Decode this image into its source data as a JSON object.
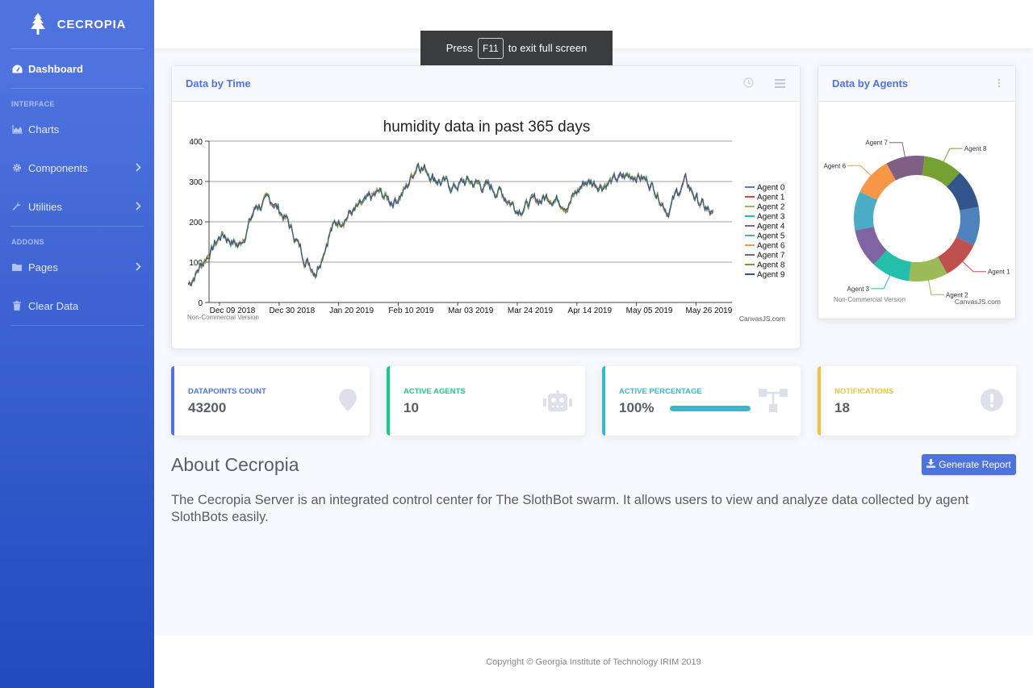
{
  "brand": {
    "name": "CECROPIA",
    "icon": "tree-icon"
  },
  "sidebar": {
    "dashboard": "Dashboard",
    "heading_interface": "INTERFACE",
    "charts": "Charts",
    "components": "Components",
    "utilities": "Utilities",
    "heading_addons": "ADDONS",
    "pages": "Pages",
    "clear_data": "Clear Data"
  },
  "fullscreen_toast": {
    "press": "Press",
    "key": "F11",
    "rest": "to exit full screen"
  },
  "time_card": {
    "title": "Data by Time",
    "icons": [
      "clock-icon",
      "menu-icon"
    ],
    "watermark_left": "Non-Commercial Version",
    "watermark_right": "CanvasJS.com"
  },
  "agents_card": {
    "title": "Data by Agents",
    "icons": [
      "more-vertical-icon"
    ],
    "watermark_left": "Non-Commercial Version",
    "watermark_right": "CanvasJS.com"
  },
  "stats": [
    {
      "label": "DATAPOINTS COUNT",
      "value": "43200",
      "color": "#4e73df",
      "icon": "map-marker-icon"
    },
    {
      "label": "ACTIVE AGENTS",
      "value": "10",
      "color": "#1cc88a",
      "icon": "robot-icon"
    },
    {
      "label": "ACTIVE PERCENTAGE",
      "value": "100%",
      "color": "#36b9cc",
      "icon": "network-icon",
      "progress": 1.0
    },
    {
      "label": "NOTIFICATIONS",
      "value": "18",
      "color": "#f6c23e",
      "icon": "exclamation-circle-icon"
    }
  ],
  "about": {
    "title": "About Cecropia",
    "text": "The Cecropia Server is an integrated control center for The SlothBot swarm. It allows users to view and analyze data collected by agent SlothBots easily.",
    "button": "Generate Report"
  },
  "footer": "Copyright © Georgia Institute of Technology IRIM 2019",
  "chart_data": [
    {
      "type": "line",
      "title": "humidity data in past 365 days",
      "x_ticks": [
        "Dec 09 2018",
        "Dec 30 2018",
        "Jan 20 2019",
        "Feb 10 2019",
        "Mar 03 2019",
        "Mar 24 2019",
        "Apr 14 2019",
        "May 05 2019",
        "May 26 2019"
      ],
      "ylim": [
        0,
        400
      ],
      "y_ticks": [
        0,
        100,
        200,
        300,
        400
      ],
      "grid": true,
      "legend_position": "right",
      "series_names": [
        "Agent 0",
        "Agent 1",
        "Agent 2",
        "Agent 3",
        "Agent 4",
        "Agent 5",
        "Agent 6",
        "Agent 7",
        "Agent 8",
        "Agent 9"
      ],
      "series_colors": [
        "#4f81bc",
        "#c0504e",
        "#9bbb58",
        "#23bfaa",
        "#8064a1",
        "#4aacc5",
        "#f79647",
        "#7f6084",
        "#77a033",
        "#33558b"
      ],
      "x": [
        "2018-11-28",
        "2018-12-05",
        "2018-12-10",
        "2018-12-16",
        "2018-12-22",
        "2018-12-28",
        "2019-01-02",
        "2019-01-08",
        "2019-01-12",
        "2019-01-17",
        "2019-01-22",
        "2019-01-28",
        "2019-02-03",
        "2019-02-08",
        "2019-02-13",
        "2019-02-17",
        "2019-02-23",
        "2019-03-01",
        "2019-03-06",
        "2019-03-12",
        "2019-03-18",
        "2019-03-24",
        "2019-03-30",
        "2019-04-05",
        "2019-04-11",
        "2019-04-17",
        "2019-04-23",
        "2019-04-29",
        "2019-05-05",
        "2019-05-11",
        "2019-05-16",
        "2019-05-22",
        "2019-05-27",
        "2019-06-01"
      ],
      "values": [
        45,
        120,
        170,
        140,
        240,
        250,
        200,
        110,
        80,
        180,
        215,
        235,
        270,
        250,
        285,
        350,
        310,
        285,
        300,
        290,
        275,
        235,
        250,
        265,
        245,
        300,
        295,
        305,
        320,
        290,
        230,
        300,
        250,
        210
      ]
    },
    {
      "type": "pie",
      "donut": true,
      "categories": [
        "Agent 0",
        "Agent 1",
        "Agent 2",
        "Agent 3",
        "Agent 4",
        "Agent 5",
        "Agent 6",
        "Agent 7",
        "Agent 8",
        "Agent 9"
      ],
      "values": [
        10,
        10,
        10,
        10,
        10,
        10,
        10,
        10,
        10,
        10
      ],
      "colors": [
        "#4f81bc",
        "#c0504e",
        "#9bbb58",
        "#23bfaa",
        "#8064a1",
        "#4aacc5",
        "#f79647",
        "#7f6084",
        "#77a033",
        "#33558b"
      ],
      "labeled": [
        "Agent 1",
        "Agent 2",
        "Agent 3",
        "Agent 6",
        "Agent 7",
        "Agent 8"
      ]
    }
  ]
}
